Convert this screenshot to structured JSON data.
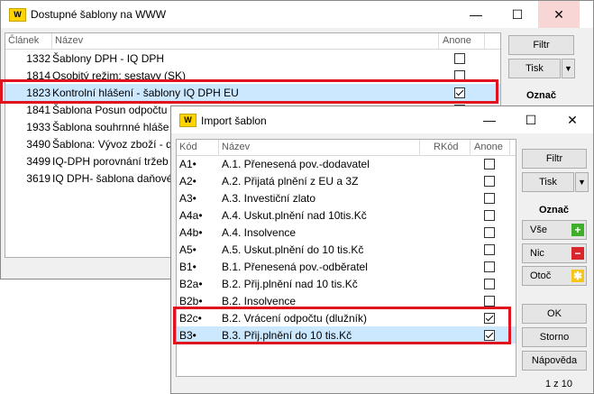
{
  "win1": {
    "logo": "W",
    "title": "Dostupné šablony na WWW",
    "columns": {
      "clanek": "Článek",
      "nazev": "Název",
      "anone": "Anone"
    },
    "rows": [
      {
        "clanek": "1332",
        "nazev": "Šablony DPH - IQ DPH",
        "checked": false
      },
      {
        "clanek": "1814",
        "nazev": "Osobitý režim: sestavy (SK)",
        "checked": false
      },
      {
        "clanek": "1823",
        "nazev": "Kontrolní hlášení - šablony IQ DPH EU",
        "checked": true
      },
      {
        "clanek": "1841",
        "nazev": "Šablona Posun odpočtu",
        "checked": false
      },
      {
        "clanek": "1933",
        "nazev": "Šablona souhrnné hláše",
        "checked": false
      },
      {
        "clanek": "3490",
        "nazev": "Šablona: Vývoz zboží - do",
        "checked": false
      },
      {
        "clanek": "3499",
        "nazev": "IQ-DPH porovnání tržeb z",
        "checked": false
      },
      {
        "clanek": "3619",
        "nazev": "IQ DPH- šablona daňové",
        "checked": false
      }
    ],
    "buttons": {
      "filtr": "Filtr",
      "tisk": "Tisk",
      "dropdown": "▼"
    },
    "oznac_label": "Označ"
  },
  "win2": {
    "logo": "W",
    "title": "Import šablon",
    "columns": {
      "kod": "Kód",
      "nazev": "Název",
      "rkod": "RKód",
      "anone": "Anone"
    },
    "rows": [
      {
        "kod": "A1•",
        "nazev": "A.1. Přenesená pov.-dodavatel",
        "checked": false
      },
      {
        "kod": "A2•",
        "nazev": "A.2. Přijatá plnění z EU a 3Z",
        "checked": false
      },
      {
        "kod": "A3•",
        "nazev": "A.3. Investiční zlato",
        "checked": false
      },
      {
        "kod": "A4a•",
        "nazev": "A.4. Uskut.plnění nad 10tis.Kč",
        "checked": false
      },
      {
        "kod": "A4b•",
        "nazev": "A.4. Insolvence",
        "checked": false
      },
      {
        "kod": "A5•",
        "nazev": "A.5. Uskut.plnění do 10 tis.Kč",
        "checked": false
      },
      {
        "kod": "B1•",
        "nazev": "B.1. Přenesená pov.-odběratel",
        "checked": false
      },
      {
        "kod": "B2a•",
        "nazev": "B.2. Přij.plnění nad 10 tis.Kč",
        "checked": false
      },
      {
        "kod": "B2b•",
        "nazev": "B.2. Insolvence",
        "checked": false
      },
      {
        "kod": "B2c•",
        "nazev": "B.2. Vrácení odpočtu (dlužník)",
        "checked": true
      },
      {
        "kod": "B3•",
        "nazev": "B.3. Přij.plnění do 10 tis.Kč",
        "checked": true
      }
    ],
    "buttons": {
      "filtr": "Filtr",
      "tisk": "Tisk",
      "dropdown": "▼",
      "vse": "Vše",
      "nic": "Nic",
      "otoc": "Otoč",
      "ok": "OK",
      "storno": "Storno",
      "napoveda": "Nápověda"
    },
    "oznac_label": "Označ",
    "status": "1 z 10",
    "colors": {
      "vse": "#3fae2a",
      "nic": "#d9262c",
      "otoc": "#f5c518"
    }
  }
}
